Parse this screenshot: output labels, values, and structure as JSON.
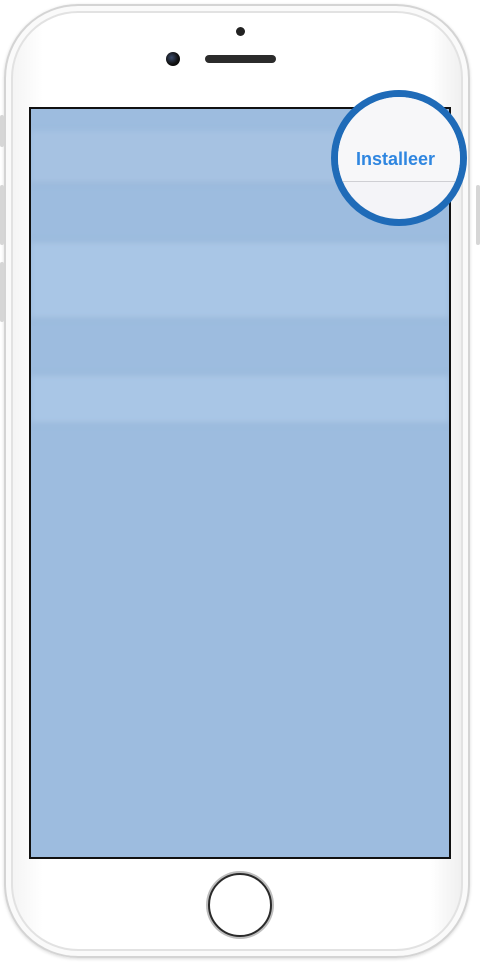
{
  "status_bar": {
    "carrier": "",
    "time": ""
  },
  "nav_bar": {
    "back_label": "",
    "title": "",
    "install_label": "Installeer"
  },
  "sections": [
    {
      "header": "",
      "body": ""
    },
    {
      "header": "",
      "body": ""
    }
  ],
  "colors": {
    "accent": "#2f86e0",
    "magnifier_ring": "#1f6bb8",
    "overlay": "#9dbcdf",
    "battery": "#4cd964"
  },
  "icons": {
    "location": "location-arrow-icon",
    "battery": "battery-icon",
    "charging": "charging-bolt-icon"
  }
}
